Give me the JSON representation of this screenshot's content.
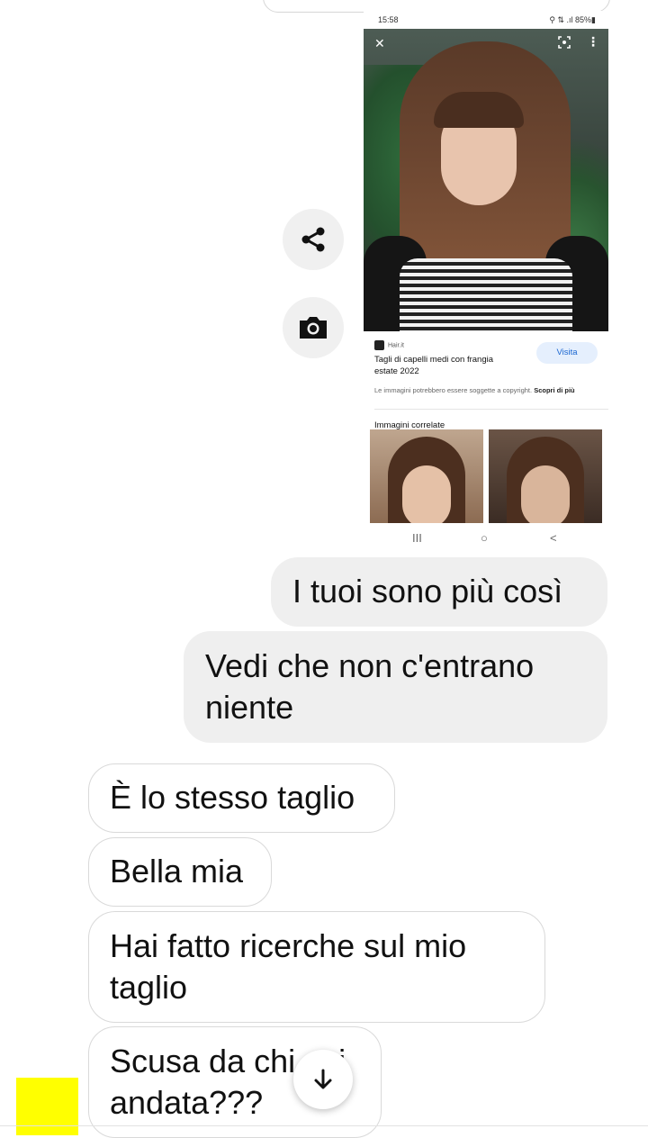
{
  "screenshot": {
    "status_time": "15:58",
    "status_icons": "⚲ ⇅ .ıl 85%▮",
    "source_name": "Hair.it",
    "result_title": "Tagli di capelli medi con frangia estate 2022",
    "visit_label": "Visita",
    "copyright_text": "Le immagini potrebbero essere soggette a copyright.",
    "learn_more": "Scopri di più",
    "related_title": "Immagini correlate",
    "nav_recents": "III",
    "nav_home": "○",
    "nav_back": "<"
  },
  "messages": {
    "sent": [
      "I tuoi sono più così",
      "Vedi che non c'entrano niente"
    ],
    "received": [
      "È lo stesso taglio",
      "Bella mia",
      "Hai fatto ricerche sul mio taglio",
      "Scusa da chi sei andata???"
    ]
  },
  "colors": {
    "sent_bubble": "#efefef",
    "received_border": "#d9d9d9",
    "yellow_square": "#ffff00",
    "visit_button": "#e5effd"
  }
}
